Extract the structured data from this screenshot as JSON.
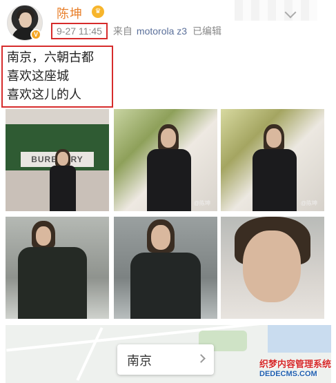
{
  "post": {
    "author": "陈坤",
    "time": "9-27 11:45",
    "source_prefix": "来自",
    "device": "motorola z3",
    "edited": "已编辑",
    "text_lines": [
      "南京，六朝古都",
      "喜欢这座城",
      "喜欢这儿的人"
    ]
  },
  "photos": {
    "p1_sign": "BURBERRY",
    "photo_watermark": "@陈坤"
  },
  "map": {
    "city": "南京"
  },
  "site_watermark": {
    "cn": "织梦内容管理系统",
    "en": "DEDECMS.COM"
  },
  "colors": {
    "username": "#e8802c",
    "highlight_box": "#d62b2b",
    "device_link": "#5a6f9a"
  },
  "icons": [
    "verified-icon",
    "vip-crown-icon",
    "chevron-down-icon",
    "chevron-right-icon"
  ]
}
